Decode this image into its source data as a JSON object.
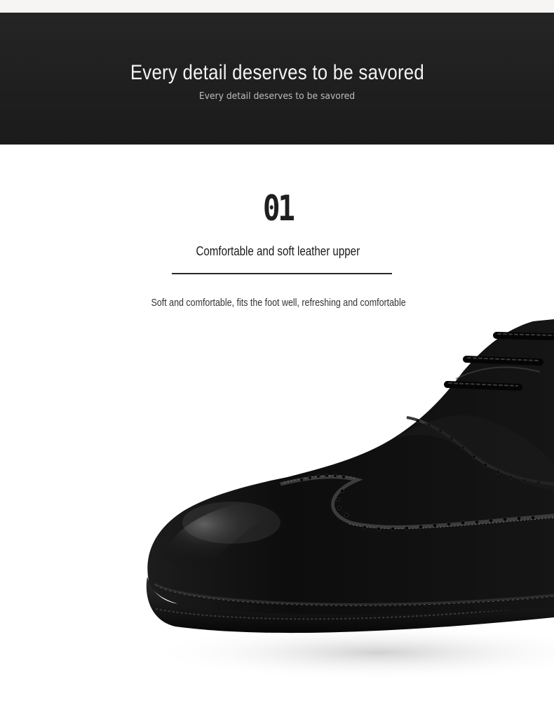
{
  "banner": {
    "title": "Every detail deserves to be savored",
    "subtitle": "Every detail deserves to be savored"
  },
  "feature": {
    "number": "01",
    "title": "Comfortable and soft leather upper",
    "description": "Soft and comfortable, fits the foot well, refreshing and comfortable"
  },
  "colors": {
    "banner_bg": "#1f1f1f",
    "page_bg": "#ffffff",
    "leather": "#111111"
  },
  "image": {
    "subject": "black-leather-brogue-shoe-closeup"
  }
}
